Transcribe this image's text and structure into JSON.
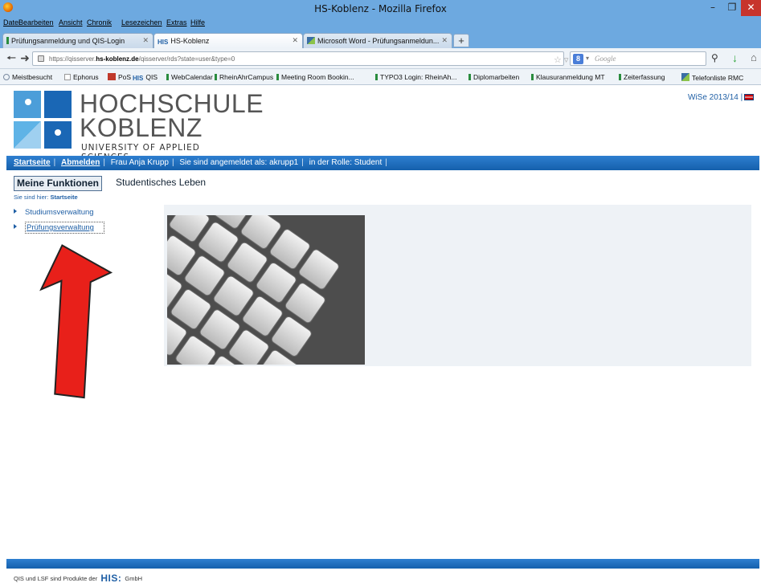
{
  "window": {
    "title": "HS-Koblenz - Mozilla Firefox"
  },
  "menu": [
    "Datei",
    "Bearbeiten",
    "Ansicht",
    "Chronik",
    "Lesezeichen",
    "Extras",
    "Hilfe"
  ],
  "tabs": [
    {
      "label": "Prüfungsanmeldung und QIS-Login"
    },
    {
      "label": "HS-Koblenz"
    },
    {
      "label": "Microsoft Word - Prüfungsanmeldun..."
    }
  ],
  "nav": {
    "url_prefix": "https://qisserver.",
    "url_domain": "hs-koblenz.de",
    "url_suffix": "/qisserver/rds?state=user&type=0",
    "search_placeholder": "Google"
  },
  "bookmarks": [
    {
      "label": "Meistbesucht",
      "color": "#7a8aa0"
    },
    {
      "label": "Ephorus",
      "color": "#ffffff"
    },
    {
      "label": "PoS",
      "color": "#c0392b"
    },
    {
      "label": "QIS",
      "color": "#1f5fa5"
    },
    {
      "label": "WebCalendar",
      "color": "#2a8c3e"
    },
    {
      "label": "RheinAhrCampus",
      "color": "#2a8c3e"
    },
    {
      "label": "Meeting Room Bookin...",
      "color": "#2a8c3e"
    },
    {
      "label": "TYPO3 Login: RheinAh...",
      "color": "#2a8c3e"
    },
    {
      "label": "Diplomarbeiten",
      "color": "#2a8c3e"
    },
    {
      "label": "Klausuranmeldung MT",
      "color": "#2a8c3e"
    },
    {
      "label": "Zeiterfassung",
      "color": "#2a8c3e"
    },
    {
      "label": "Telefonliste RMC",
      "color": "#3a6ea5"
    }
  ],
  "page": {
    "logo_line1": "HOCHSCHULE",
    "logo_line2": "KOBLENZ",
    "logo_line3": "UNIVERSITY OF APPLIED SCIENCES",
    "semester": "WiSe 2013/14 |",
    "topbar": {
      "home": "Startseite",
      "logout": "Abmelden",
      "user": "Frau Anja Krupp",
      "logged_in": "Sie sind angemeldet als: akrupp1",
      "role": "in der Rolle: Student"
    },
    "tab_functions": "Meine Funktionen",
    "tab_life": "Studentisches Leben",
    "breadcrumb_prefix": "Sie sind hier:",
    "breadcrumb_current": "Startseite",
    "menu_items": [
      "Studiumsverwaltung",
      "Prüfungsverwaltung"
    ],
    "footer_prefix": "QIS und LSF sind Produkte der",
    "footer_brand": "HIS:",
    "footer_suffix": "GmbH"
  }
}
